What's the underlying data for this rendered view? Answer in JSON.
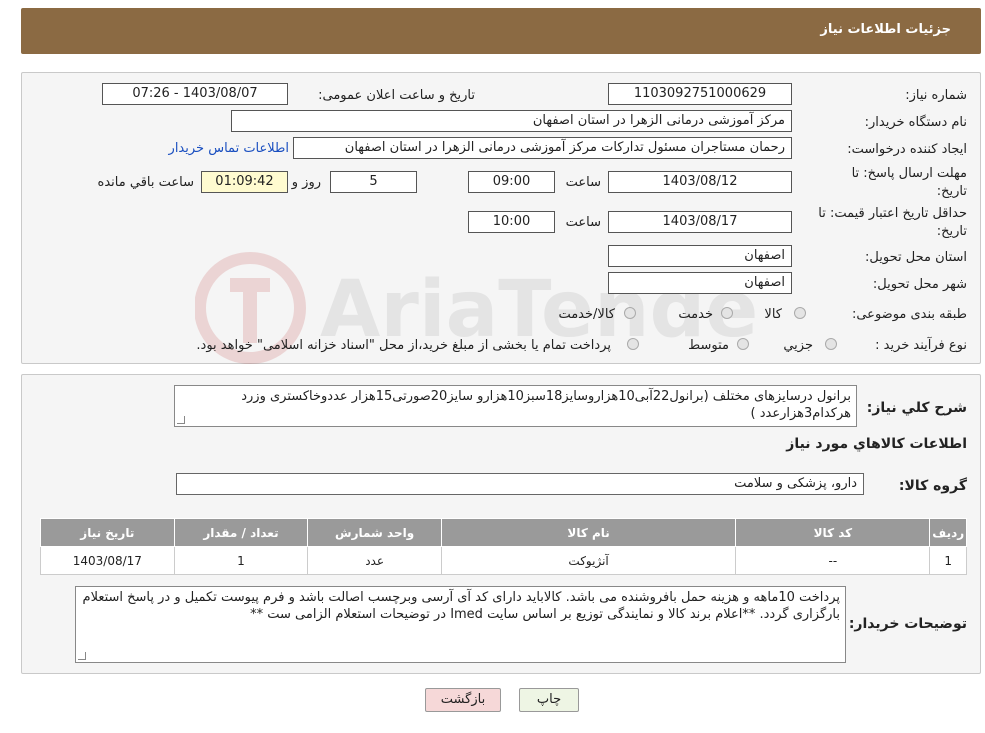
{
  "header": {
    "title": "جزئیات اطلاعات نیاز"
  },
  "form": {
    "need_number_label": "شماره نیاز:",
    "need_number": "1103092751000629",
    "announce_label": "تاریخ و ساعت اعلان عمومی:",
    "announce_value": "1403/08/07 - 07:26",
    "buyer_org_label": "نام دستگاه خریدار:",
    "buyer_org": "مرکز آموزشی درمانی الزهرا در استان اصفهان",
    "creator_label": "ایجاد کننده درخواست:",
    "creator": "رحمان مستاجران مسئول تدارکات مرکز آموزشی درمانی الزهرا در استان اصفهان",
    "contact_link": "اطلاعات تماس خریدار",
    "reply_deadline_label_1": "مهلت ارسال پاسخ: تا",
    "reply_deadline_label_2": "تاریخ:",
    "reply_date": "1403/08/12",
    "hour_label": "ساعت",
    "reply_time": "09:00",
    "days_value": "5",
    "days_label": "روز و",
    "remaining_time": "01:09:42",
    "remaining_label": "ساعت باقي مانده",
    "price_validity_label_1": "حداقل تاریخ اعتبار قیمت: تا",
    "price_validity_label_2": "تاریخ:",
    "validity_date": "1403/08/17",
    "validity_time": "10:00",
    "province_label": "استان محل تحویل:",
    "province": "اصفهان",
    "city_label": "شهر محل تحویل:",
    "city": "اصفهان",
    "category_label": "طبقه بندی موضوعی:",
    "category_options": [
      "کالا",
      "خدمت",
      "کالا/خدمت"
    ],
    "purchase_type_label": "نوع فرآیند خرید :",
    "purchase_options": [
      "جزیي",
      "متوسط"
    ],
    "purchase_note": "پرداخت تمام یا بخشی از مبلغ خرید،از محل \"اسناد خزانه اسلامی\" خواهد بود."
  },
  "details": {
    "summary_label": "شرح كلي نياز:",
    "summary": "برانول درسایزهای مختلف (برانول22آبی10هزاروسایز18سبز10هزارو سایز20صورتی15هزار عددوخاکستری وزرد هرکدام3هزارعدد )",
    "goods_info_title": "اطلاعات كالاهاي مورد نياز",
    "goods_group_label": "گروه کالا:",
    "goods_group": "دارو، پزشکی و سلامت",
    "table": {
      "headers": [
        "ردیف",
        "کد کالا",
        "نام کالا",
        "واحد شمارش",
        "تعداد / مقدار",
        "تاریخ نیاز"
      ],
      "rows": [
        [
          "1",
          "--",
          "آنژیوکت",
          "عدد",
          "1",
          "1403/08/17"
        ]
      ]
    },
    "buyer_notes_label": "توضیحات خریدار:",
    "buyer_notes": "پرداخت 10ماهه و  هزینه حمل بافروشنده می باشد. کالاباید دارای کد آی آرسی وبرچسب اصالت باشد و فرم پیوست تکمیل و در پاسخ استعلام بارگزاری گردد. **اعلام برند کالا و نمایندگی توزیع بر اساس سایت Imed در توضیحات استعلام الزامی ست **"
  },
  "buttons": {
    "print": "چاپ",
    "back": "بازگشت"
  },
  "watermark": {
    "text": "AriaTender.neT"
  },
  "colors": {
    "header": "#8b6a43",
    "link": "#1a4fc0",
    "back_button": "#f6d8d8",
    "print_button": "#eef5e4"
  }
}
